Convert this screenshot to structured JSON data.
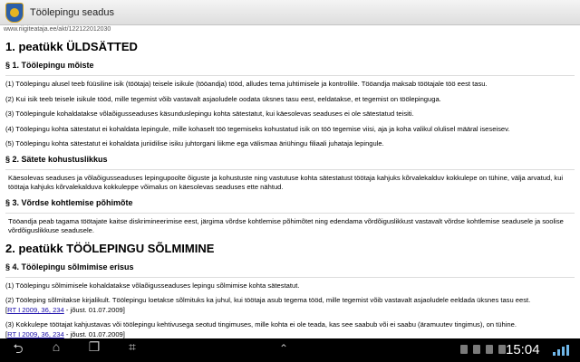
{
  "app": {
    "title": "Töölepingu seadus"
  },
  "url": "www.riigiteataja.ee/akt/122122012030",
  "content": {
    "chapter1": "1. peatükk ÜLDSÄTTED",
    "s1_title": "§ 1. Töölepingu mõiste",
    "s1_p1": "(1) Töölepingu alusel teeb füüsiline isik (töötaja) teisele isikule (tööandja) tööd, alludes tema juhtimisele ja kontrollile. Tööandja maksab töötajale töö eest tasu.",
    "s1_p2": "(2) Kui isik teeb teisele isikule tööd, mille tegemist võib vastavalt asjaoludele oodata üksnes tasu eest, eeldatakse, et tegemist on töölepinguga.",
    "s1_p3": "(3) Töölepingule kohaldatakse võlaõigusseaduses käsunduslepingu kohta sätestatut, kui käesolevas seaduses ei ole sätestatud teisiti.",
    "s1_p4": "(4) Töölepingu kohta sätestatut ei kohaldata lepingule, mille kohaselt töö tegemiseks kohustatud isik on töö tegemise viisi, aja ja koha valikul olulisel määral iseseisev.",
    "s1_p5": "(5) Töölepingu kohta sätestatut ei kohaldata juriidilise isiku juhtorgani liikme ega välismaa äriühingu filiaali juhataja lepingule.",
    "s2_title": "§ 2. Sätete kohustuslikkus",
    "s2_p1": "Käesolevas seaduses ja võlaõigusseaduses lepingupoolte õiguste ja kohustuste ning vastutuse kohta sätestatust töötaja kahjuks kõrvalekalduv kokkulepe on tühine, välja arvatud, kui töötaja kahjuks kõrvalekalduva kokkuleppe võimalus on käesolevas seaduses ette nähtud.",
    "s3_title": "§ 3. Võrdse kohtlemise põhimõte",
    "s3_p1": "Tööandja peab tagama töötajate kaitse diskrimineerimise eest, järgima võrdse kohtlemise põhimõtet ning edendama võrdõiguslikkust vastavalt võrdse kohtlemise seadusele ja soolise võrdõiguslikkuse seadusele.",
    "chapter2": "2. peatükk TÖÖLEPINGU SÕLMIMINE",
    "s4_title": "§ 4. Töölepingu sõlmimise erisus",
    "s4_p1": "(1) Töölepingu sõlmimisele kohaldatakse võlaõigusseaduses lepingu sõlmimise kohta sätestatut.",
    "s4_p2": "(2) Tööleping sõlmitakse kirjalikult. Töölepingu loetakse sõlmituks ka juhul, kui töötaja asub tegema tööd, mille tegemist võib vastavalt asjaoludele eeldada üksnes tasu eest.",
    "s4_p2_link": "RT I 2009, 36, 234",
    "s4_p2_suffix": " - jõust. 01.07.2009]",
    "s4_p3": "(3) Kokkulepe töötajat kahjustavas või töölepingu kehtivusega seotud tingimuses, mille kohta ei ole teada, kas see saabub või ei saabu (äramuutev tingimus), on tühine.",
    "s4_p3_link": "RT I 2009, 36, 234",
    "s4_p3_suffix": " - jõust. 01.07.2009]"
  },
  "statusbar": {
    "time": "15:04"
  },
  "icons": {
    "back": "back-icon",
    "home": "home-icon",
    "recents": "recents-icon",
    "screenshot": "screenshot-icon",
    "up": "chevron-up-icon"
  }
}
